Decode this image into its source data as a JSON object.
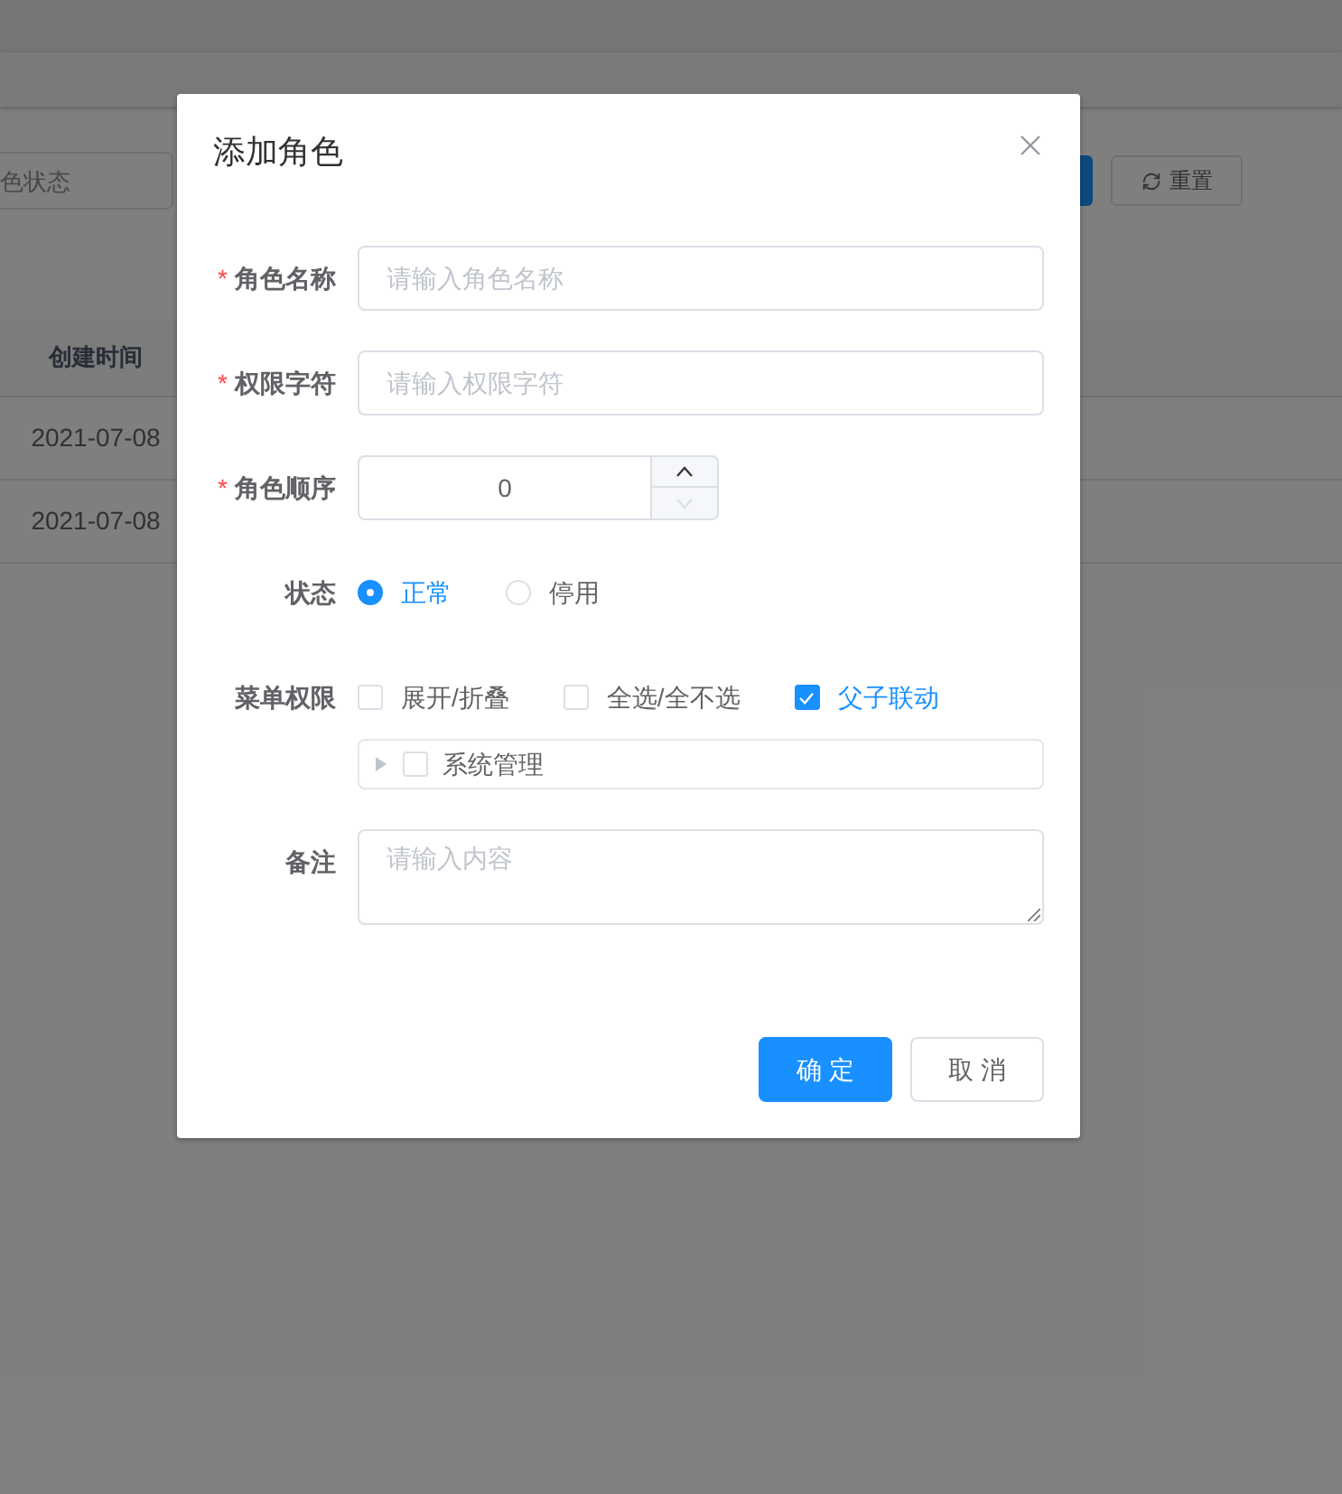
{
  "background_page": {
    "search_field": {
      "placeholder": "色状态"
    },
    "reset_button": {
      "label": "重置"
    },
    "table": {
      "columns": [
        "创建时间"
      ],
      "rows": [
        [
          "2021-07-08"
        ],
        [
          "2021-07-08"
        ]
      ]
    }
  },
  "dialog": {
    "title": "添加角色",
    "fields": [
      {
        "kind": "text",
        "required_mark": "*",
        "label": "角色名称",
        "placeholder": "请输入角色名称"
      },
      {
        "kind": "text",
        "required_mark": "*",
        "label": "权限字符",
        "placeholder": "请输入权限字符"
      },
      {
        "kind": "number",
        "required_mark": "*",
        "label": "角色顺序",
        "value": "0",
        "controls": [
          {
            "kind": "increment",
            "disabled": false
          },
          {
            "kind": "decrement",
            "disabled": true
          }
        ]
      },
      {
        "kind": "radio",
        "label": "状态",
        "options": [
          {
            "label": "正常",
            "selected": true
          },
          {
            "label": "停用",
            "selected": false
          }
        ]
      },
      {
        "kind": "tree",
        "label": "菜单权限",
        "options": [
          {
            "label": "展开/折叠",
            "checked": false
          },
          {
            "label": "全选/全不选",
            "checked": false
          },
          {
            "label": "父子联动",
            "checked": true
          }
        ],
        "tree": [
          {
            "label": "系统管理",
            "checked": false,
            "expanded": false
          }
        ]
      },
      {
        "kind": "textarea",
        "label": "备注",
        "placeholder": "请输入内容"
      }
    ],
    "buttons": [
      {
        "kind": "primary",
        "label": "确 定"
      },
      {
        "kind": "default",
        "label": "取 消"
      }
    ]
  }
}
